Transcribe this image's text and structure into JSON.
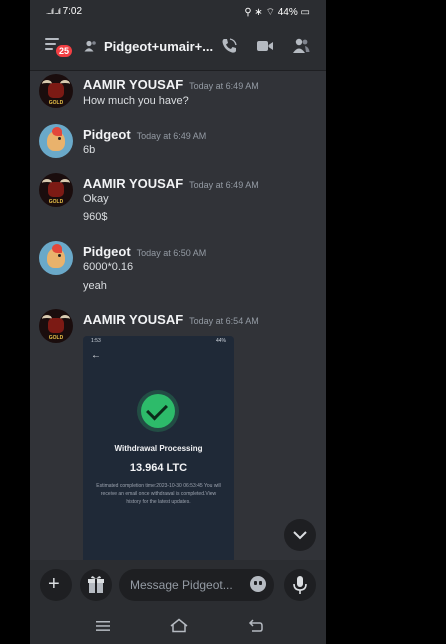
{
  "status_bar": {
    "signal": "....ıl ...ıl",
    "time": "7:02",
    "right": "⚲ ∗ ⌔ 44% ▭"
  },
  "header": {
    "unread_badge": "25",
    "channel_title": "Pidgeot+umair+..."
  },
  "messages": [
    {
      "author": "AAMIR YOUSAF",
      "timestamp": "Today at 6:49 AM",
      "avatar": "bull-gold-avatar",
      "lines": [
        "How much you have?"
      ]
    },
    {
      "author": "Pidgeot",
      "timestamp": "Today at 6:49 AM",
      "avatar": "pidgeot-avatar",
      "lines": [
        "6b"
      ]
    },
    {
      "author": "AAMIR YOUSAF",
      "timestamp": "Today at 6:49 AM",
      "avatar": "bull-gold-avatar",
      "lines": [
        "Okay",
        "960$"
      ]
    },
    {
      "author": "Pidgeot",
      "timestamp": "Today at 6:50 AM",
      "avatar": "pidgeot-avatar",
      "lines": [
        "6000*0.16",
        "yeah"
      ]
    },
    {
      "author": "AAMIR YOUSAF",
      "timestamp": "Today at 6:54 AM",
      "avatar": "bull-gold-avatar",
      "lines": []
    }
  ],
  "avatar_text": {
    "bull": "GOLD"
  },
  "attachment": {
    "status_time": "1:53",
    "status_right": "44%",
    "title": "Withdrawal Processing",
    "amount": "13.964 LTC",
    "note": "Estimated completion time:2023-10-30 06:53:45 You will receive an email once withdrawal is completed.View history for the latest updates."
  },
  "composer": {
    "placeholder": "Message Pidgeot..."
  },
  "colors": {
    "background": "#313338",
    "bars": "#2b2d31",
    "badge": "#f23f43",
    "success": "#2dbb6a"
  }
}
